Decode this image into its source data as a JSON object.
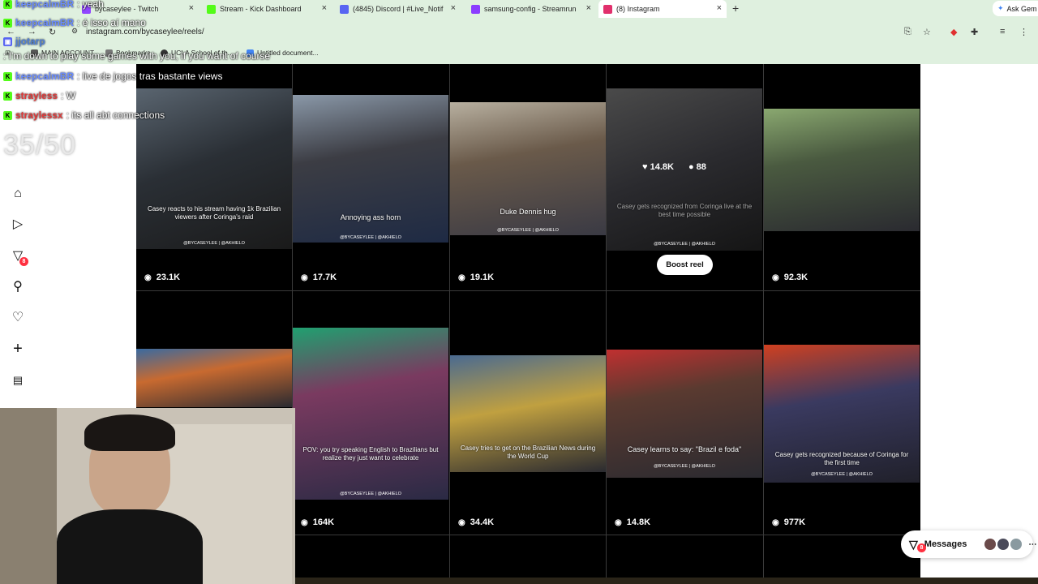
{
  "tabs": [
    {
      "label": "bycaseylee - Twitch",
      "color": "#9146ff",
      "active": false
    },
    {
      "label": "Stream - Kick Dashboard",
      "color": "#53fc18",
      "active": false
    },
    {
      "label": "(4845) Discord | #Live_Notif",
      "color": "#5865f2",
      "active": false
    },
    {
      "label": "samsung-config - Streamrun",
      "color": "#8b3dff",
      "active": false
    },
    {
      "label": "(8) Instagram",
      "color": "#e1306c",
      "active": true
    }
  ],
  "new_tab": "+",
  "ask_gemini": "Ask Gem",
  "address": {
    "url": "instagram.com/bycaseylee/reels/"
  },
  "bookmarks": [
    {
      "label": "MAIN ACCOUNT",
      "color": "#555555"
    },
    {
      "label": "Bookmarks",
      "color": "#777777"
    },
    {
      "label": "UCLA School of th...",
      "color": "#333333"
    },
    {
      "label": "Untitled document...",
      "color": "#4285f4"
    }
  ],
  "sidebar": {
    "notification_badge": "8"
  },
  "reels": [
    {
      "views": "23.1K",
      "caption": "Casey reacts to his stream having 1k Brazilian viewers after Coringa's raid",
      "handle": "@BYCASEYLEE | @AKHIELO"
    },
    {
      "views": "17.7K",
      "caption": "Annoying ass horn",
      "handle": "@BYCASEYLEE | @AKHIELO"
    },
    {
      "views": "19.1K",
      "caption": "Duke Dennis hug",
      "handle": "@BYCASEYLEE | @AKHIELO"
    },
    {
      "views": "",
      "caption": "Casey gets recognized from Coringa live at the best time possible",
      "handle": "@BYCASEYLEE | @AKHIELO"
    },
    {
      "views": "92.3K",
      "caption": "",
      "handle": ""
    },
    {
      "views": "",
      "caption": "",
      "handle": ""
    },
    {
      "views": "164K",
      "caption": "POV: you try speaking English to Brazilians but realize they just want to celebrate",
      "handle": "@BYCASEYLEE | @AKHIELO"
    },
    {
      "views": "34.4K",
      "caption": "Casey tries to get on the Brazilian News during the World Cup",
      "handle": "@BYCASEYLEE | @AKHIELO"
    },
    {
      "views": "14.8K",
      "caption": "Casey learns to say: \"Brazil e foda\"",
      "handle": "@BYCASEYLEE | @AKHIELO"
    },
    {
      "views": "977K",
      "caption": "Casey gets recognized because of Coringa for the first time",
      "handle": "@BYCASEYLEE | @AKHIELO"
    }
  ],
  "hover": {
    "likes": "14.8K",
    "comments": "88",
    "boost_label": "Boost reel"
  },
  "messages": {
    "label": "Messages",
    "badge": "8"
  },
  "chat": [
    {
      "user": "keepcalmBR",
      "text": ": yeah",
      "color": "#6a8cff",
      "badge": "K"
    },
    {
      "user": "keepcalmBR",
      "text": ": é isso aí mano",
      "color": "#6a8cff",
      "badge": "K"
    },
    {
      "user": "jjotarp",
      "text": ": I'm down to play some games with you, if you want of course",
      "color": "#4f7fd6",
      "badge": ""
    },
    {
      "user": "keepcalmBR",
      "text": ": live de jogos tras bastante views",
      "color": "#6a8cff",
      "badge": "K"
    },
    {
      "user": "strayless",
      "text": ": W",
      "color": "#e23a3a",
      "badge": "K"
    },
    {
      "user": "straylessx",
      "text": ": its all abt connections",
      "color": "#e23a3a",
      "badge": "K"
    }
  ],
  "counter": "35/50"
}
